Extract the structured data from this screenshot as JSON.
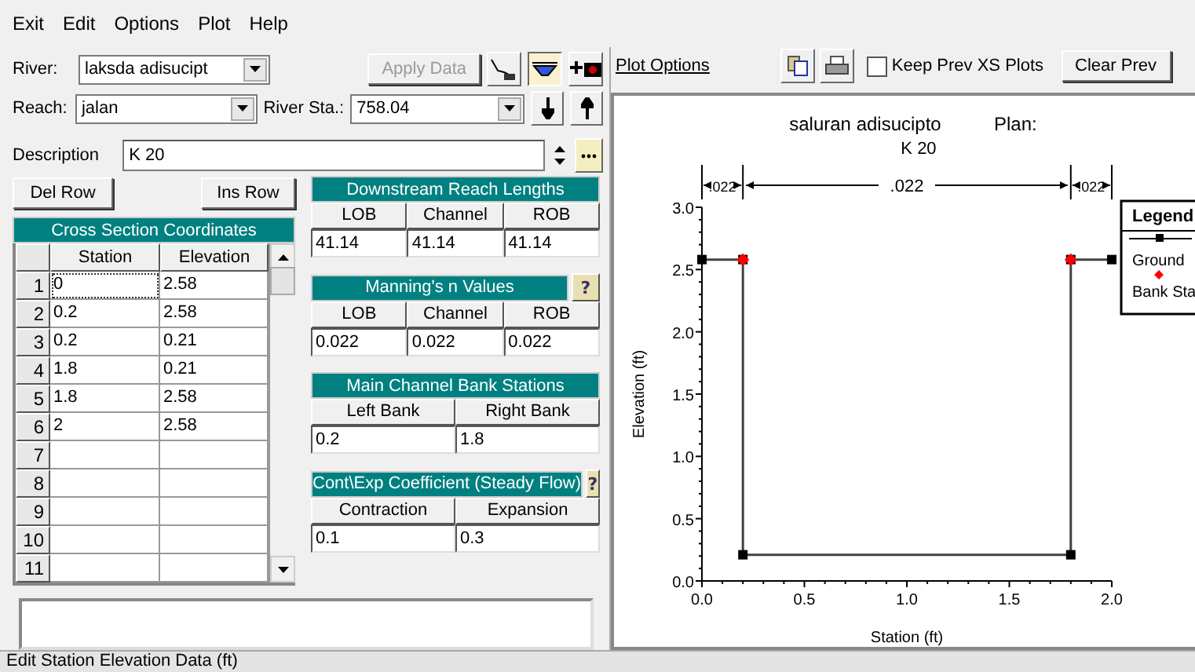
{
  "menu": [
    "Exit",
    "Edit",
    "Options",
    "Plot",
    "Help"
  ],
  "river": {
    "label": "River:",
    "value": "laksda adisucipt"
  },
  "reach": {
    "label": "Reach:",
    "value": "jalan"
  },
  "river_sta": {
    "label": "River Sta.:",
    "value": "758.04"
  },
  "apply_button": {
    "label": "Apply Data",
    "disabled": true
  },
  "tool_icons": [
    {
      "kind": "plan",
      "selected": false
    },
    {
      "kind": "section",
      "selected": true
    },
    {
      "kind": "add-photo",
      "selected": false
    }
  ],
  "description": {
    "label": "Description",
    "value": "K 20"
  },
  "row_buttons": [
    "Del Row",
    "Ins Row"
  ],
  "cross_section": {
    "title": "Cross Section Coordinates",
    "columns": [
      "Station",
      "Elevation"
    ],
    "rows": [
      {
        "num": "1",
        "station": "0",
        "elevation": "2.58",
        "selected": true
      },
      {
        "num": "2",
        "station": "0.2",
        "elevation": "2.58",
        "selected": false
      },
      {
        "num": "3",
        "station": "0.2",
        "elevation": "0.21",
        "selected": false
      },
      {
        "num": "4",
        "station": "1.8",
        "elevation": "0.21",
        "selected": false
      },
      {
        "num": "5",
        "station": "1.8",
        "elevation": "2.58",
        "selected": false
      },
      {
        "num": "6",
        "station": "2",
        "elevation": "2.58",
        "selected": false
      },
      {
        "num": "7",
        "selected": false
      },
      {
        "num": "8",
        "selected": false
      },
      {
        "num": "9",
        "selected": false
      },
      {
        "num": "10",
        "selected": false
      },
      {
        "num": "11",
        "selected": false
      }
    ]
  },
  "groups": [
    {
      "title": "Downstream Reach Lengths",
      "columns": [
        "LOB",
        "Channel",
        "ROB"
      ],
      "values": [
        "41.14",
        "41.14",
        "41.14"
      ]
    },
    {
      "title": "Manning's n Values",
      "help_label": "?",
      "columns": [
        "LOB",
        "Channel",
        "ROB"
      ],
      "values": [
        "0.022",
        "0.022",
        "0.022"
      ]
    },
    {
      "title": "Main Channel Bank Stations",
      "columns": [
        "Left Bank",
        "Right Bank"
      ],
      "values": [
        "0.2",
        "1.8"
      ]
    },
    {
      "title": "Cont\\Exp Coefficient (Steady Flow)",
      "help_label": "?",
      "columns": [
        "Contraction",
        "Expansion"
      ],
      "values": [
        "0.1",
        "0.3"
      ]
    }
  ],
  "status_bar": "Edit Station Elevation Data (ft)",
  "plot_options": "Plot Options",
  "keep_prev": {
    "label": "Keep Prev XS Plots",
    "checked": false
  },
  "clear_prev": "Clear Prev",
  "plot": {
    "title": "saluran adisucipto",
    "plan_label": "Plan:",
    "subtitle": "K 20",
    "n_labels": [
      ".022",
      ".022",
      ".022"
    ],
    "legend_title": "Legend",
    "bank_legend": {
      "label": "Bank Sta",
      "color": "#ff0000"
    },
    "chart_data": {
      "type": "line",
      "xlabel": "Station (ft)",
      "ylabel": "Elevation (ft)",
      "x": [
        0,
        0.2,
        0.2,
        1.8,
        1.8,
        2
      ],
      "series": [
        {
          "name": "Ground",
          "color": "#000000",
          "marker": "square",
          "values": [
            2.58,
            2.58,
            0.21,
            0.21,
            2.58,
            2.58
          ]
        }
      ],
      "xlim": [
        0,
        2
      ],
      "ylim": [
        0,
        3
      ],
      "xticks": [
        {
          "value": 0,
          "label": "0.0"
        },
        {
          "value": 0.5,
          "label": "0.5"
        },
        {
          "value": 1,
          "label": "1.0"
        },
        {
          "value": 1.5,
          "label": "1.5"
        },
        {
          "value": 2,
          "label": "2.0"
        }
      ],
      "yticks": [
        {
          "value": 0,
          "label": "0.0"
        },
        {
          "value": 0.5,
          "label": "0.5"
        },
        {
          "value": 1,
          "label": "1.0"
        },
        {
          "value": 1.5,
          "label": "1.5"
        },
        {
          "value": 2,
          "label": "2.0"
        },
        {
          "value": 2.5,
          "label": "2.5"
        },
        {
          "value": 3,
          "label": "3.0"
        }
      ]
    }
  }
}
